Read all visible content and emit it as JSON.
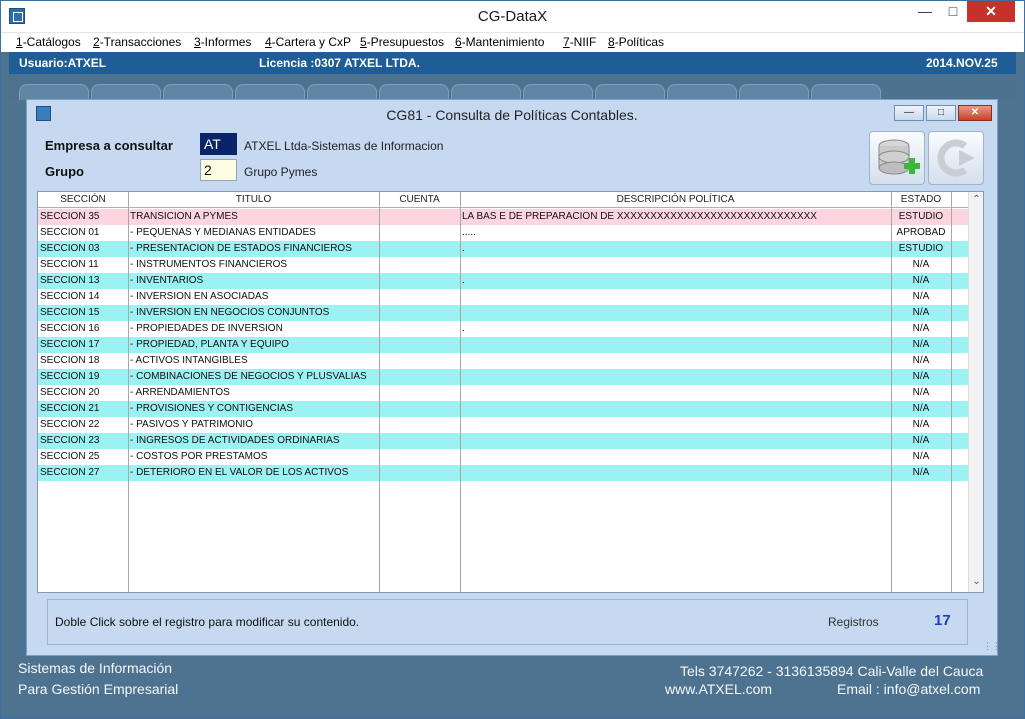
{
  "window": {
    "title": "CG-DataX"
  },
  "menu": [
    {
      "key": "1",
      "rest": "-Catálogos"
    },
    {
      "key": "2",
      "rest": "-Transacciones"
    },
    {
      "key": "3",
      "rest": "-Informes"
    },
    {
      "key": "4",
      "rest": "-Cartera y CxP"
    },
    {
      "key": "5",
      "rest": "-Presupuestos"
    },
    {
      "key": "6",
      "rest": "-Mantenimiento"
    },
    {
      "key": "7",
      "rest": "-NIIF"
    },
    {
      "key": "8",
      "rest": "-Políticas"
    }
  ],
  "userbar": {
    "user": "Usuario:ATXEL",
    "license": "Licencia :0307 ATXEL LTDA.",
    "date": "2014.NOV.25"
  },
  "dialog": {
    "title": "CG81 - Consulta de Políticas Contables.",
    "company_label": "Empresa a consultar",
    "company_code": "AT",
    "company_name": "ATXEL Ltda-Sistemas de Informacion",
    "group_label": "Grupo",
    "group_code": "2",
    "group_name": "Grupo Pymes"
  },
  "grid": {
    "columns": [
      "SECCIÓN",
      "TITULO",
      "CUENTA",
      "DESCRIPCIÓN POLÍTICA",
      "ESTADO"
    ],
    "rows": [
      {
        "seccion": "SECCION  35",
        "titulo": "TRANSICION  A  PYMES",
        "cuenta": "",
        "descripcion": "LA BAS E DE PREPARACION DE   XXXXXXXXXXXXXXXXXXXXXXXXXXXXXX",
        "estado": "ESTUDIO"
      },
      {
        "seccion": "SECCION 01",
        "titulo": "- PEQUEÑAS Y MEDIANAS ENTIDADES",
        "cuenta": "",
        "descripcion": ".....",
        "estado": "APROBAD"
      },
      {
        "seccion": "SECCION 03",
        "titulo": "- PRESENTACION DE ESTADOS FINANCIEROS",
        "cuenta": "",
        "descripcion": ".",
        "estado": "ESTUDIO"
      },
      {
        "seccion": "SECCION 11",
        "titulo": "- INSTRUMENTOS FINANCIEROS",
        "cuenta": "",
        "descripcion": "",
        "estado": "N/A"
      },
      {
        "seccion": "SECCION 13",
        "titulo": "- INVENTARIOS",
        "cuenta": "",
        "descripcion": ".",
        "estado": "N/A"
      },
      {
        "seccion": "SECCION 14",
        "titulo": "- INVERSION EN ASOCIADAS",
        "cuenta": "",
        "descripcion": "",
        "estado": "N/A"
      },
      {
        "seccion": "SECCION 15",
        "titulo": "- INVERSION EN NEGOCIOS CONJUNTOS",
        "cuenta": "",
        "descripcion": "",
        "estado": "N/A"
      },
      {
        "seccion": "SECCION 16",
        "titulo": "- PROPIEDADES DE INVERSION",
        "cuenta": "",
        "descripcion": ".",
        "estado": "N/A"
      },
      {
        "seccion": "SECCION 17",
        "titulo": "- PROPIEDAD, PLANTA Y EQUIPO",
        "cuenta": "",
        "descripcion": "",
        "estado": "N/A"
      },
      {
        "seccion": "SECCION 18",
        "titulo": "- ACTIVOS INTANGIBLES",
        "cuenta": "",
        "descripcion": "",
        "estado": "N/A"
      },
      {
        "seccion": "SECCION 19",
        "titulo": "- COMBINACIONES DE NEGOCIOS Y PLUSVALIAS",
        "cuenta": "",
        "descripcion": "",
        "estado": "N/A"
      },
      {
        "seccion": "SECCION 20",
        "titulo": "- ARRENDAMIENTOS",
        "cuenta": "",
        "descripcion": "",
        "estado": "N/A"
      },
      {
        "seccion": "SECCION 21",
        "titulo": "- PROVISIONES Y CONTIGENCIAS",
        "cuenta": "",
        "descripcion": "",
        "estado": "N/A"
      },
      {
        "seccion": "SECCION 22",
        "titulo": "- PASIVOS Y PATRIMONIO",
        "cuenta": "",
        "descripcion": "",
        "estado": "N/A"
      },
      {
        "seccion": "SECCION 23",
        "titulo": "- INGRESOS DE ACTIVIDADES ORDINARIAS",
        "cuenta": "",
        "descripcion": "",
        "estado": "N/A"
      },
      {
        "seccion": "SECCION 25",
        "titulo": "- COSTOS POR PRESTAMOS",
        "cuenta": "",
        "descripcion": "",
        "estado": "N/A"
      },
      {
        "seccion": "SECCION 27",
        "titulo": "- DETERIORO EN EL VALOR DE LOS ACTIVOS",
        "cuenta": "",
        "descripcion": "",
        "estado": "N/A"
      }
    ]
  },
  "status": {
    "message": "Doble Click sobre el registro para modificar su contenido.",
    "records_label": "Registros",
    "records_value": "17"
  },
  "footer": {
    "line1_left": "Sistemas de Información",
    "line2_left": "Para Gestión Empresarial",
    "phones": "Tels 3747262 - 3136135894 Cali-Valle del Cauca",
    "web": "www.ATXEL.com",
    "email": "Email : info@atxel.com"
  },
  "colors": {
    "row_alt": "#9cf1f2",
    "row_highlight": "#fdd5e0",
    "user_bar": "#1e5d96",
    "dialog_bg": "#c6d9f1",
    "records_value": "#1a3cc8"
  },
  "icons": {
    "app": "app-icon",
    "add_database": "database-add-icon",
    "exit": "exit-arrow-icon"
  }
}
